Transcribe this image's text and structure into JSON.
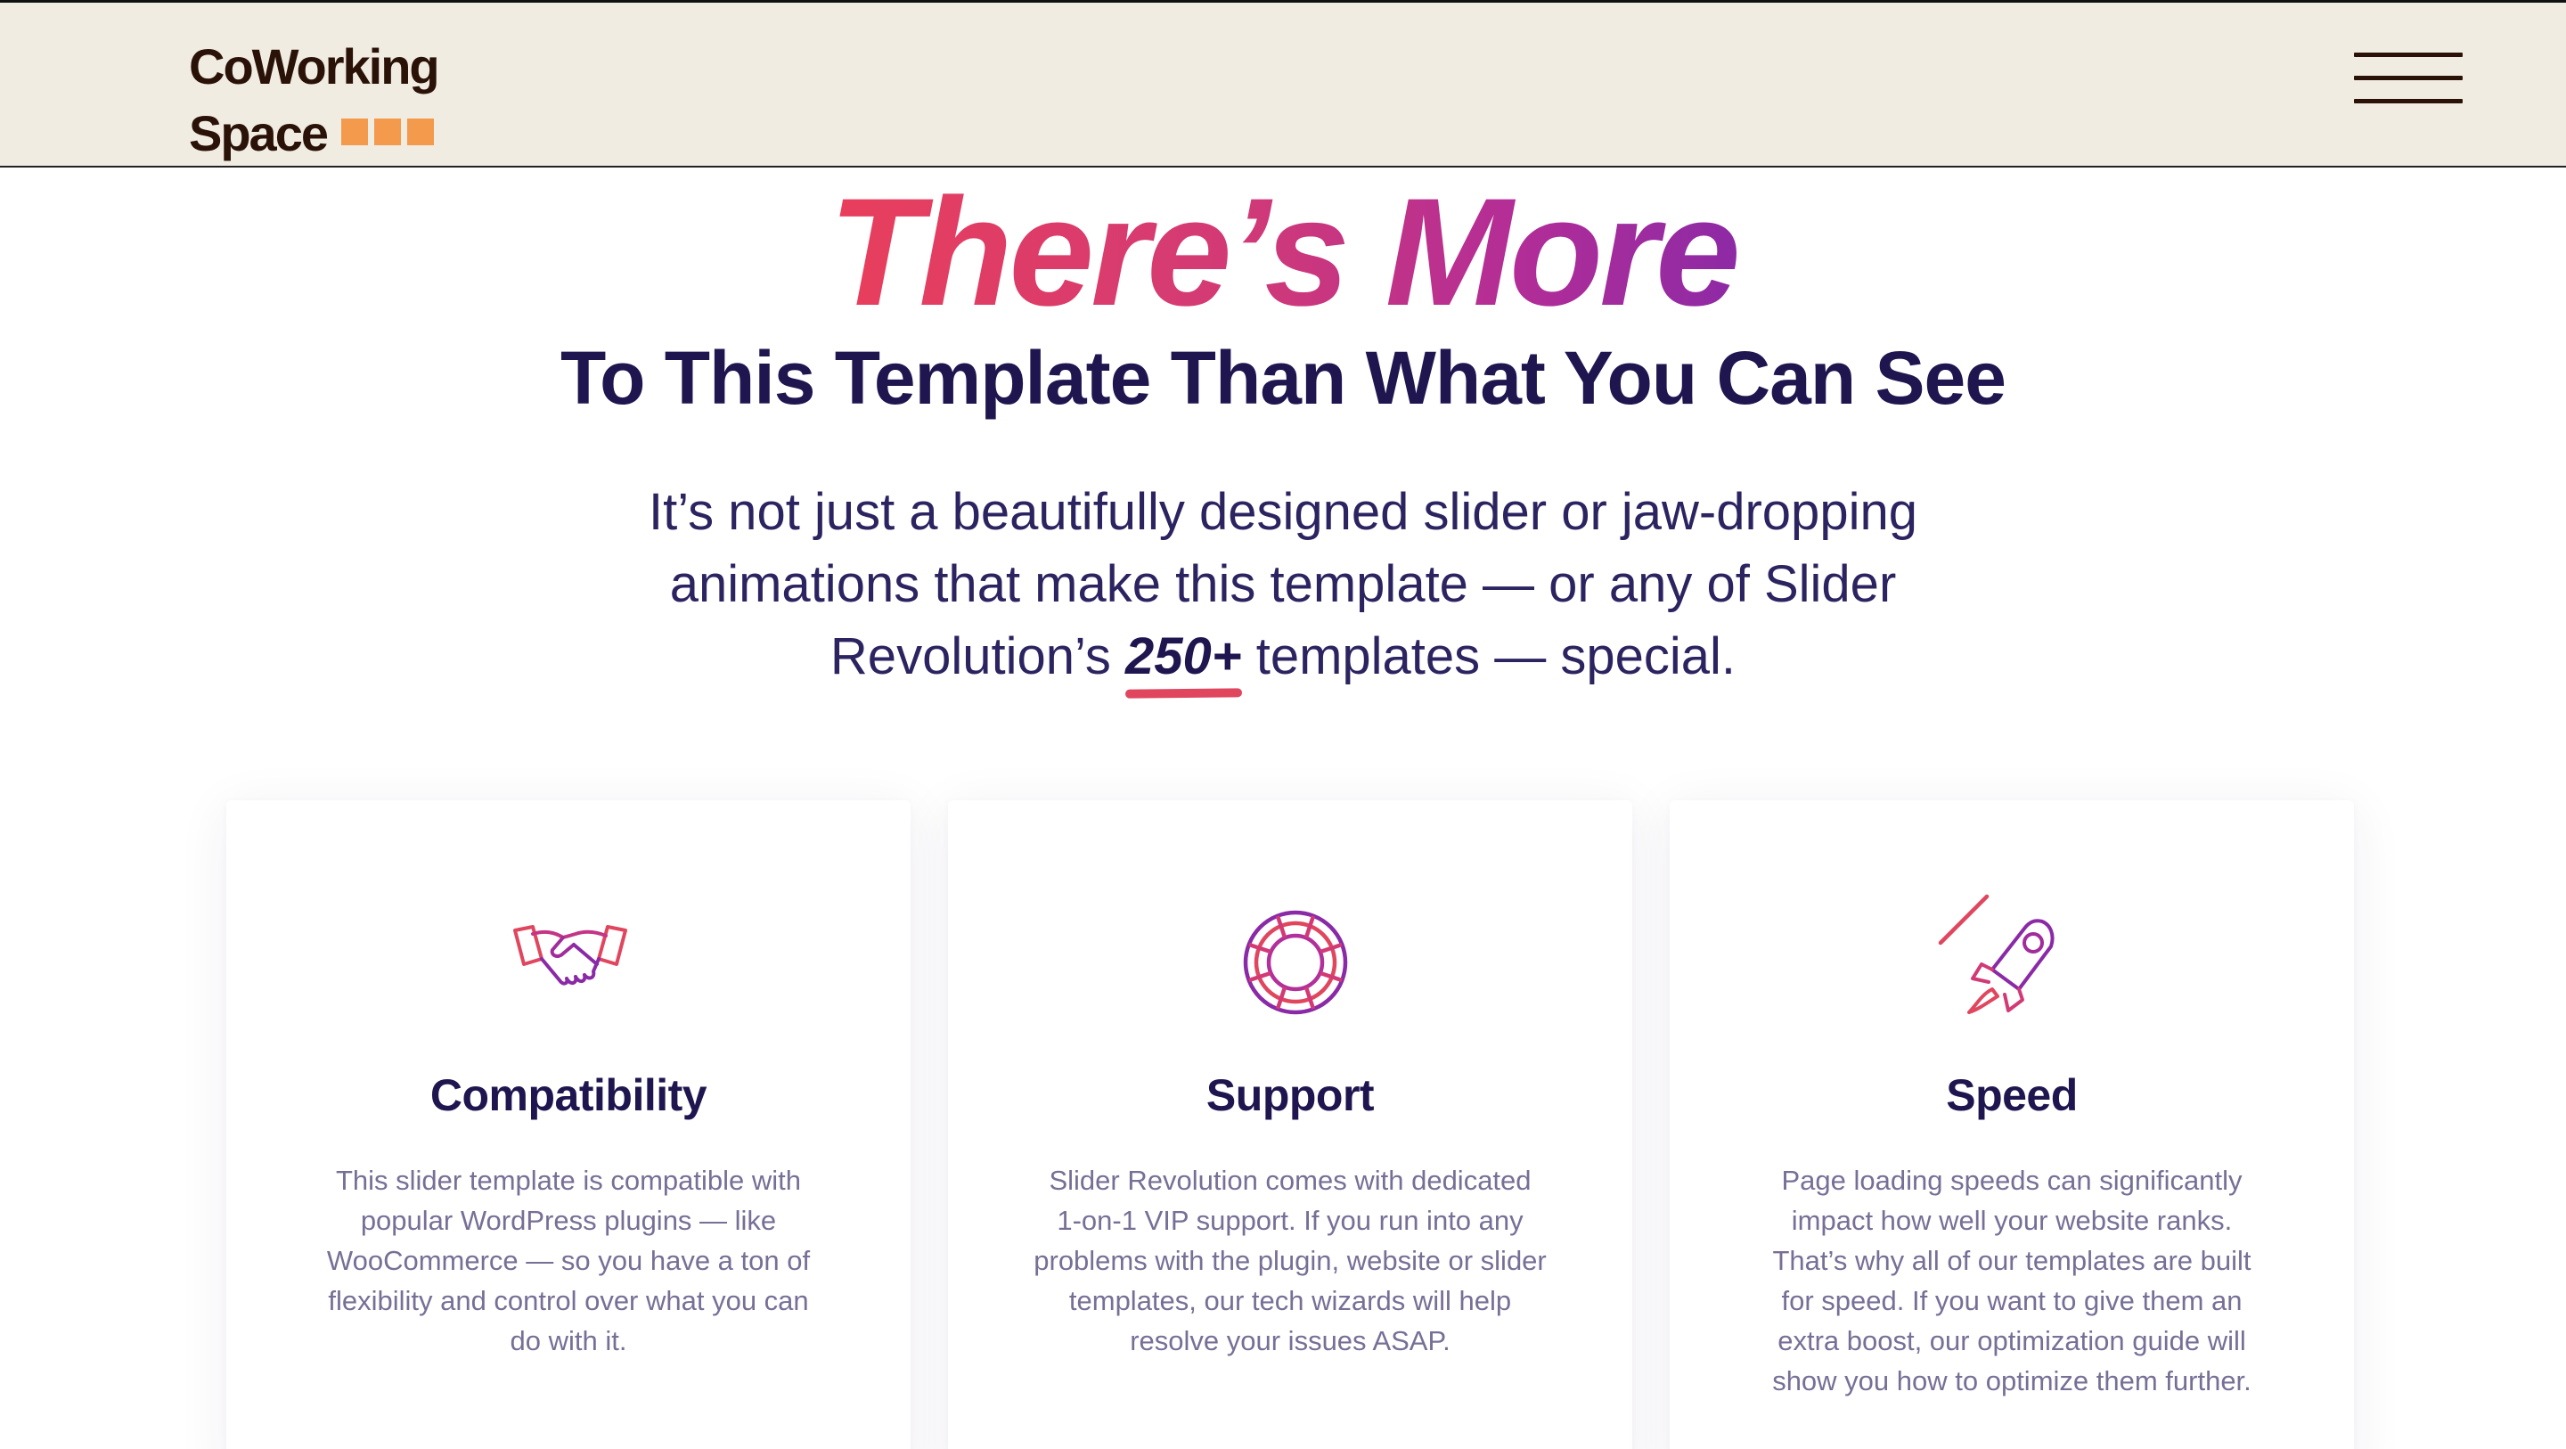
{
  "header": {
    "logo_line1": "CoWorking",
    "logo_line2": "Space",
    "menu_icon": "hamburger-menu-icon"
  },
  "hero": {
    "title": "There’s More",
    "subtitle": "To This Template Than What You Can See",
    "intro_part1": "It’s not just a beautifully designed slider or jaw-dropping animations that make this template — or any of Slider Revolution’s ",
    "intro_highlight": "250+",
    "intro_part2": " templates — special."
  },
  "features": [
    {
      "icon": "handshake-icon",
      "title": "Compatibility",
      "text": "This slider template is compatible with popular WordPress plugins — like WooCommerce — so you have a ton of flexibility and control over what you can do with it."
    },
    {
      "icon": "lifebuoy-icon",
      "title": "Support",
      "text": "Slider Revolution comes with dedicated 1-on-1 VIP support. If you run into any problems with the plugin, website or slider templates, our tech wizards will help resolve your issues ASAP."
    },
    {
      "icon": "rocket-icon",
      "title": "Speed",
      "text": "Page loading speeds can significantly impact how well your website ranks. That’s why all of our templates are built for speed. If you want to give them an extra boost, our optimization guide will show you how to optimize them further."
    }
  ],
  "colors": {
    "header_bg": "#f1ece1",
    "logo_text": "#2a1208",
    "logo_accent": "#f39a4d",
    "heading": "#1f1650",
    "gradient_start": "#ea3f5a",
    "gradient_end": "#8a2aa6",
    "body_text": "#776f96",
    "underline": "#e0465e"
  }
}
